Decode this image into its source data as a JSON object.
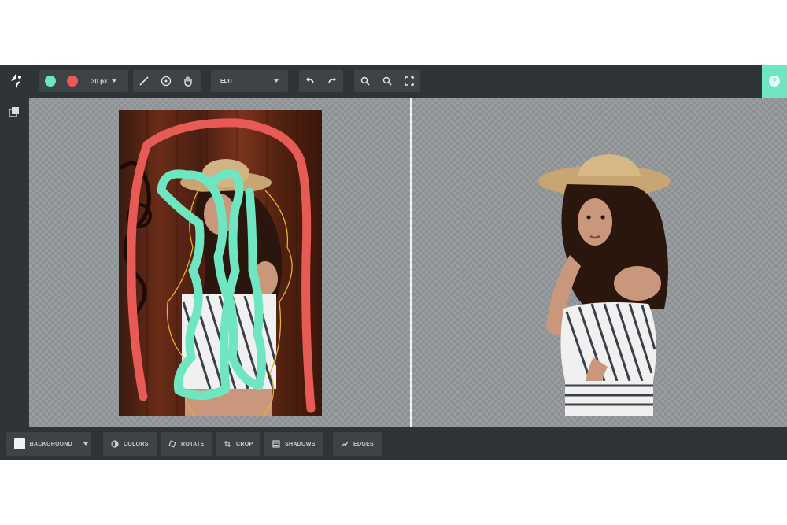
{
  "toolbar": {
    "brush_size": "30 px",
    "mode": "EDIT",
    "colors": {
      "keep": "#6ee6c1",
      "remove": "#e85a55",
      "accent": "#6ee6c1"
    },
    "icons": [
      "keep-color-icon",
      "remove-color-icon",
      "pen-icon",
      "eraser-circle-icon",
      "hand-pan-icon",
      "undo-icon",
      "redo-icon",
      "zoom-out-icon",
      "zoom-in-icon",
      "fit-screen-icon",
      "help-icon"
    ]
  },
  "sidebar": {
    "icons": [
      "layers-icon"
    ]
  },
  "bottom": {
    "background_label": "BACKGROUND",
    "colors_label": "COLORS",
    "rotate_label": "ROTATE",
    "crop_label": "CROP",
    "shadows_label": "SHADOWS",
    "edges_label": "EDGES"
  }
}
